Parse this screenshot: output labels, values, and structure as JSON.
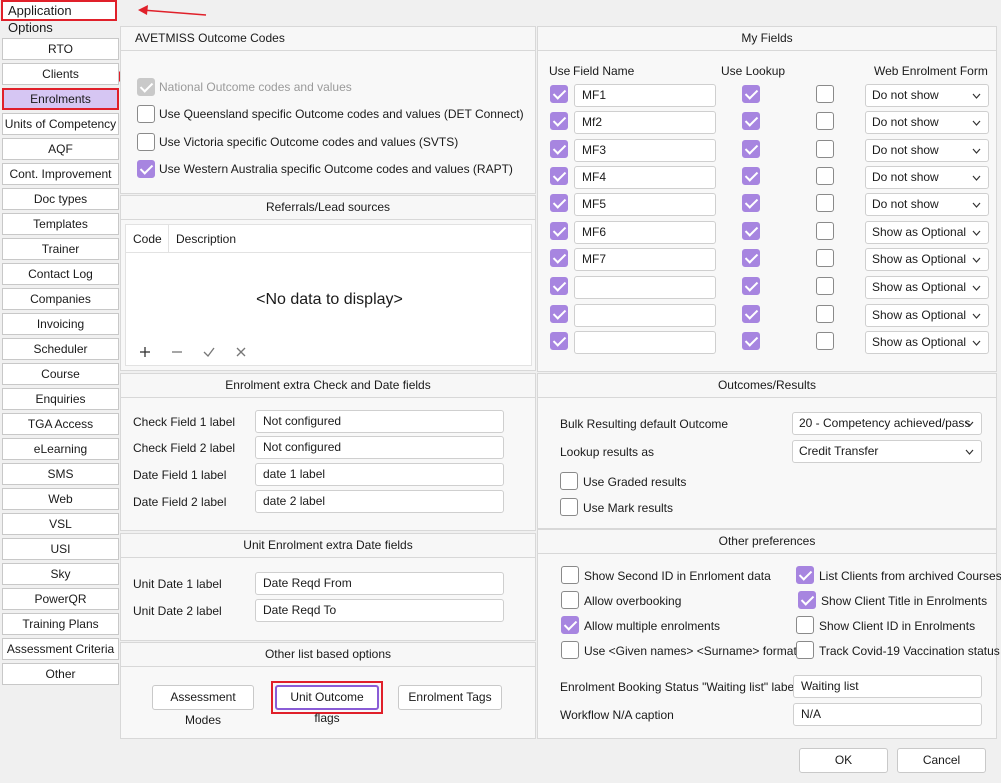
{
  "window": {
    "title": "Application Options"
  },
  "nav": {
    "items": [
      "RTO",
      "Clients",
      "Enrolments",
      "Units of Competency",
      "AQF",
      "Cont. Improvement",
      "Doc types",
      "Templates",
      "Trainer",
      "Contact Log",
      "Companies",
      "Invoicing",
      "Scheduler",
      "Course",
      "Enquiries",
      "TGA Access",
      "eLearning",
      "SMS",
      "Web",
      "VSL",
      "USI",
      "Sky",
      "PowerQR",
      "Training Plans",
      "Assessment Criteria",
      "Other"
    ],
    "active": "Enrolments"
  },
  "avetmiss": {
    "title": "AVETMISS Outcome Codes",
    "options": [
      {
        "label": "National Outcome codes and values",
        "checked": true,
        "disabled": true
      },
      {
        "label": "Use Queensland specific Outcome codes and values (DET Connect)",
        "checked": false,
        "disabled": false
      },
      {
        "label": "Use Victoria specific Outcome codes and values (SVTS)",
        "checked": false,
        "disabled": false
      },
      {
        "label": "Use Western Australia specific Outcome codes and values (RAPT)",
        "checked": true,
        "disabled": false
      }
    ]
  },
  "referrals": {
    "title": "Referrals/Lead sources",
    "columns": [
      "Code",
      "Description"
    ],
    "empty_text": "<No data to display>"
  },
  "enrolment_extra": {
    "title": "Enrolment extra Check and Date fields",
    "rows": [
      {
        "label": "Check Field 1  label",
        "value": "Not configured"
      },
      {
        "label": "Check Field 2 label",
        "value": "Not configured"
      },
      {
        "label": "Date Field 1 label",
        "value": "date 1 label"
      },
      {
        "label": "Date Field 2 label",
        "value": "date 2 label"
      }
    ]
  },
  "unit_enrolment": {
    "title": "Unit Enrolment extra Date fields",
    "rows": [
      {
        "label": "Unit Date 1 label",
        "value": "Date Reqd From"
      },
      {
        "label": "Unit Date 2 label",
        "value": "Date Reqd To"
      }
    ]
  },
  "other_list": {
    "title": "Other list based options",
    "buttons": [
      "Assessment Modes",
      "Unit Outcome flags",
      "Enrolment Tags"
    ]
  },
  "my_fields": {
    "title": "My Fields",
    "headers": {
      "use": "Use",
      "field_name": "Field Name",
      "use_lookup": "Use Lookup",
      "web_form": "Web Enrolment Form"
    },
    "rows": [
      {
        "use": true,
        "name": "MF1",
        "lookup": true,
        "extra": false,
        "web": "Do not show"
      },
      {
        "use": true,
        "name": "Mf2",
        "lookup": true,
        "extra": false,
        "web": "Do not show"
      },
      {
        "use": true,
        "name": "MF3",
        "lookup": true,
        "extra": false,
        "web": "Do not show"
      },
      {
        "use": true,
        "name": "MF4",
        "lookup": true,
        "extra": false,
        "web": "Do not show"
      },
      {
        "use": true,
        "name": "MF5",
        "lookup": true,
        "extra": false,
        "web": "Do not show"
      },
      {
        "use": true,
        "name": "MF6",
        "lookup": true,
        "extra": false,
        "web": "Show as Optional"
      },
      {
        "use": true,
        "name": "MF7",
        "lookup": true,
        "extra": false,
        "web": "Show as Optional"
      },
      {
        "use": true,
        "name": "",
        "lookup": true,
        "extra": false,
        "web": "Show as Optional"
      },
      {
        "use": true,
        "name": "",
        "lookup": true,
        "extra": false,
        "web": "Show as Optional"
      },
      {
        "use": true,
        "name": "",
        "lookup": true,
        "extra": false,
        "web": "Show as Optional"
      }
    ]
  },
  "outcomes": {
    "title": "Outcomes/Results",
    "bulk_label": "Bulk Resulting default Outcome",
    "bulk_value": "20 - Competency achieved/pass",
    "lookup_label": "Lookup results as",
    "lookup_value": "Credit Transfer",
    "graded_label": "Use Graded results",
    "graded_checked": false,
    "mark_label": "Use Mark results",
    "mark_checked": false
  },
  "other_prefs": {
    "title": "Other preferences",
    "left": [
      {
        "label": "Show Second ID in Enrloment data",
        "checked": false
      },
      {
        "label": "Allow overbooking",
        "checked": false
      },
      {
        "label": "Allow multiple enrolments",
        "checked": true
      },
      {
        "label": "Use <Given names> <Surname> format",
        "checked": false
      }
    ],
    "right": [
      {
        "label": "List Clients from archived Courses",
        "checked": true
      },
      {
        "label": "Show Client Title in Enrolments",
        "checked": true
      },
      {
        "label": "Show Client ID in Enrolments",
        "checked": false
      },
      {
        "label": "Track Covid-19 Vaccination status",
        "checked": false
      }
    ],
    "waiting_label": "Enrolment Booking Status \"Waiting list\" label",
    "waiting_value": "Waiting list",
    "workflow_label": "Workflow N/A caption",
    "workflow_value": "N/A"
  },
  "footer": {
    "ok": "OK",
    "cancel": "Cancel"
  },
  "colors": {
    "accent": "#a785e0",
    "highlight": "#e0202a",
    "nav_active": "#d6c6f3"
  }
}
